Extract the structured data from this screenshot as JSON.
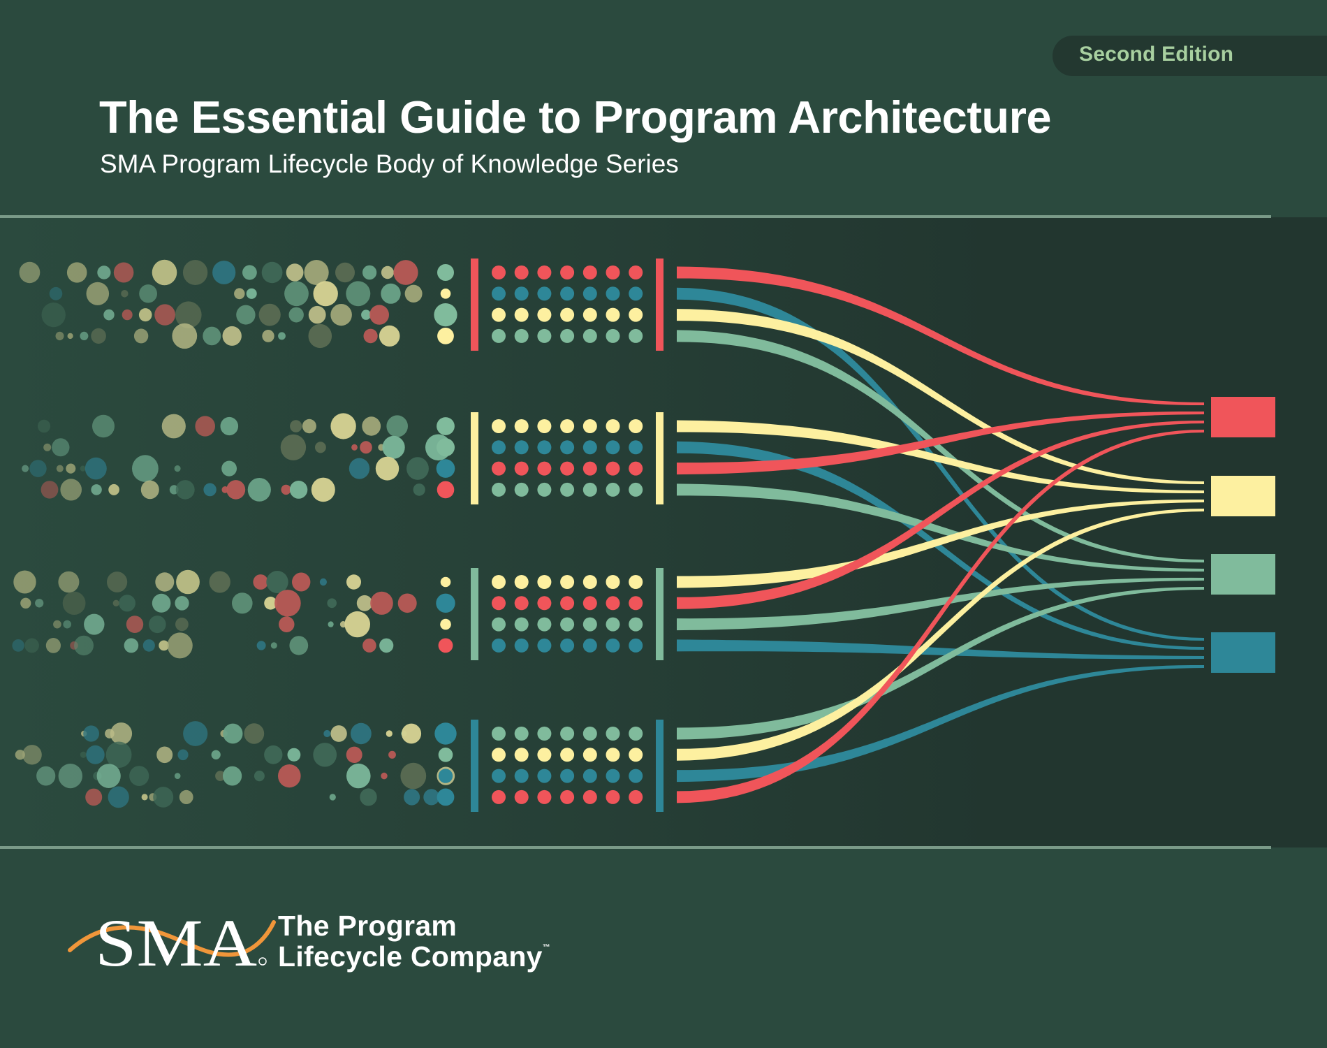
{
  "cover": {
    "edition": "Second Edition",
    "title": "The Essential Guide to Program Architecture",
    "subtitle": "SMA Program Lifecycle Body of Knowledge Series"
  },
  "logo": {
    "mark": "SMA",
    "tagline_line1": "The Program",
    "tagline_line2": "Lifecycle Company",
    "trademark": "™",
    "swoosh_color": "#f0963a"
  },
  "colors": {
    "background": "#2b4a3e",
    "band": "#22362f",
    "divider": "#7a9a88",
    "red": "#f0555a",
    "yellow": "#fdf0a0",
    "green": "#80bb9c",
    "teal": "#2e8798",
    "badge_text": "#a8d0a0"
  },
  "illustration": {
    "groups": [
      {
        "bar_color": "red",
        "rows": [
          "red",
          "teal",
          "yellow",
          "green"
        ]
      },
      {
        "bar_color": "yellow",
        "rows": [
          "yellow",
          "teal",
          "red",
          "green"
        ]
      },
      {
        "bar_color": "green",
        "rows": [
          "yellow",
          "red",
          "green",
          "teal"
        ]
      },
      {
        "bar_color": "teal",
        "rows": [
          "green",
          "yellow",
          "teal",
          "red"
        ]
      }
    ],
    "dots_per_row": 7,
    "targets": [
      "red",
      "yellow",
      "green",
      "teal"
    ]
  }
}
